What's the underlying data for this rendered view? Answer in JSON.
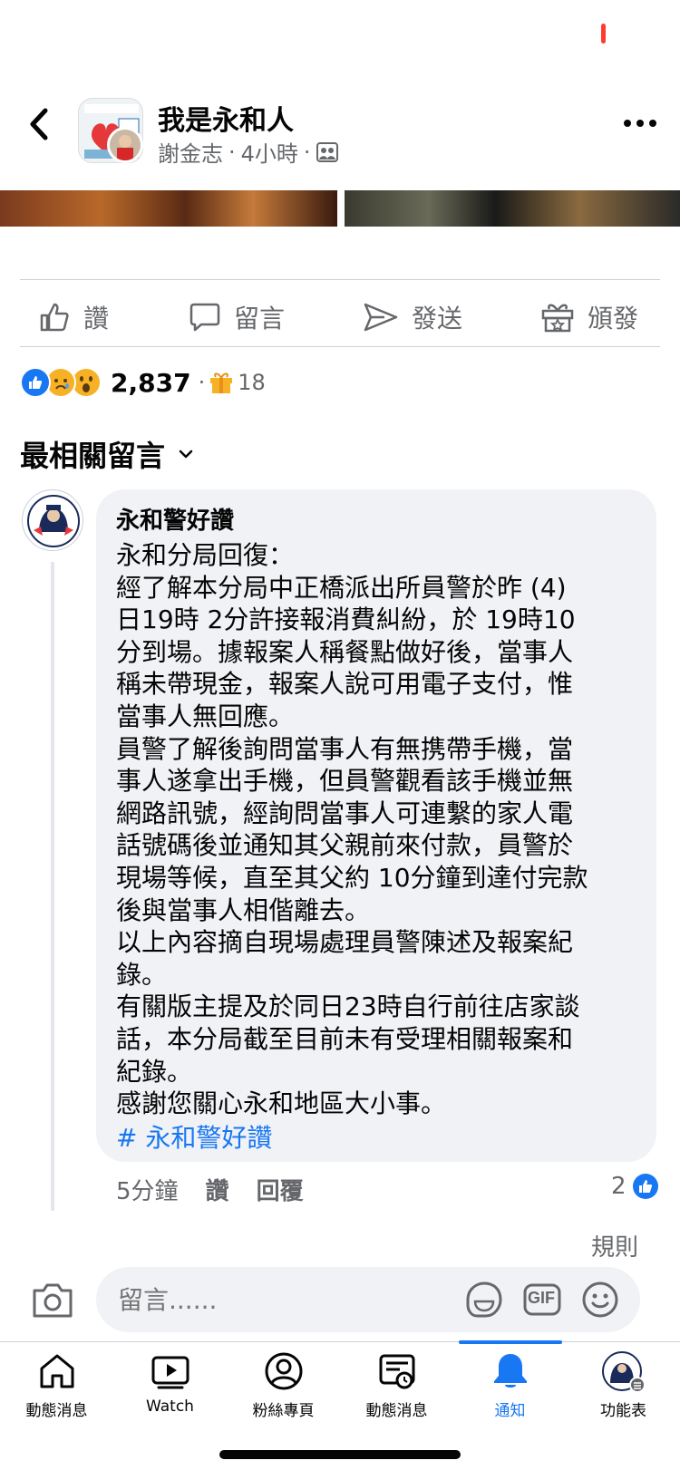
{
  "header": {
    "group_name": "我是永和人",
    "author": "謝金志",
    "separator": "·",
    "time": "4小時",
    "visibility_icon": "group-members-icon"
  },
  "actions": {
    "like": "讚",
    "comment": "留言",
    "send": "發送",
    "gift": "頒發"
  },
  "reactions": {
    "types": [
      "like",
      "sad",
      "wow"
    ],
    "count": "2,837",
    "separator": "·",
    "gift_count": "18"
  },
  "comments_section": {
    "sort_label": "最相關留言"
  },
  "comment": {
    "author": "永和警好讚",
    "lines": [
      "永和分局回復：",
      "經了解本分局中正橋派出所員警於昨 (4)",
      "日19時 2分許接報消費糾紛，於 19時10",
      "分到場。據報案人稱餐點做好後，當事人",
      "稱未帶現金，報案人說可用電子支付，惟",
      "當事人無回應。",
      "員警了解後詢問當事人有無携帶手機，當",
      "事人遂拿出手機，但員警觀看該手機並無",
      "網路訊號，經詢問當事人可連繫的家人電",
      "話號碼後並通知其父親前來付款，員警於",
      "現場等候，直至其父約 10分鐘到達付完款",
      "後與當事人相偕離去。",
      "以上內容摘自現場處理員警陳述及報案紀",
      "錄。",
      "有關版主提及於同日23時自行前往店家談",
      "話，本分局截至目前未有受理相關報案和",
      "紀錄。",
      "感謝您關心永和地區大小事。"
    ],
    "hashtag": "# 永和警好讚",
    "time": "5分鐘",
    "like_label": "讚",
    "reply_label": "回覆",
    "like_count": "2"
  },
  "composer": {
    "rules_link": "規則",
    "placeholder": "留言......",
    "gif_label": "GIF"
  },
  "nav": {
    "items": [
      {
        "label": "動態消息",
        "icon": "home-icon"
      },
      {
        "label": "Watch",
        "icon": "watch-icon"
      },
      {
        "label": "粉絲專頁",
        "icon": "profile-icon"
      },
      {
        "label": "動態消息",
        "icon": "feeds-icon"
      },
      {
        "label": "通知",
        "icon": "bell-icon",
        "active": true
      },
      {
        "label": "功能表",
        "icon": "menu-avatar-icon"
      }
    ]
  },
  "colors": {
    "accent": "#1877f2",
    "secondary_text": "#65676b",
    "bubble": "#f0f2f5"
  }
}
